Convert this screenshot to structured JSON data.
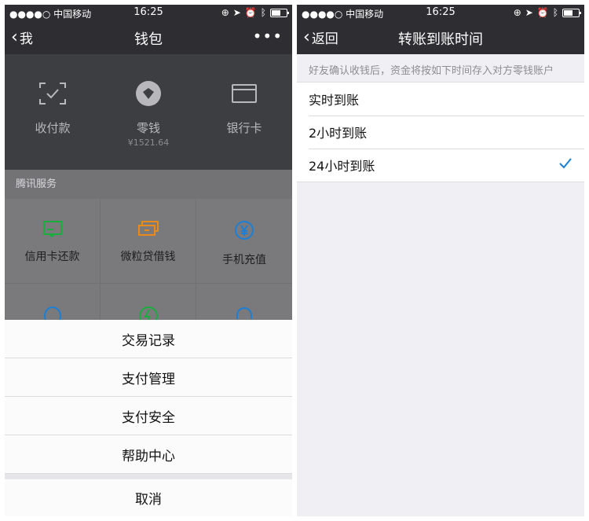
{
  "left": {
    "status": {
      "carrier": "●●●●○ 中国移动",
      "time": "16:25"
    },
    "nav": {
      "back": "我",
      "title": "钱包",
      "more": "•••"
    },
    "wallet": [
      {
        "label": "收付款",
        "sub": "",
        "icon": "scan-pay-icon"
      },
      {
        "label": "零钱",
        "sub": "¥1521.64",
        "icon": "change-icon"
      },
      {
        "label": "银行卡",
        "sub": "",
        "icon": "bank-card-icon"
      }
    ],
    "section_label": "腾讯服务",
    "services": [
      {
        "label": "信用卡还款",
        "icon": "credit-card-icon",
        "color": "#19ad3e"
      },
      {
        "label": "微粒贷借钱",
        "icon": "loan-icon",
        "color": "#e98b1c"
      },
      {
        "label": "手机充值",
        "icon": "yuan-icon",
        "color": "#1a7fd6"
      }
    ],
    "sheet": {
      "items": [
        "交易记录",
        "支付管理",
        "支付安全",
        "帮助中心"
      ],
      "cancel": "取消"
    }
  },
  "right": {
    "status": {
      "carrier": "●●●●○ 中国移动",
      "time": "16:25"
    },
    "nav": {
      "back": "返回",
      "title": "转账到账时间"
    },
    "note": "好友确认收钱后，资金将按如下时间存入对方零钱账户",
    "options": [
      {
        "label": "实时到账",
        "selected": false
      },
      {
        "label": "2小时到账",
        "selected": false
      },
      {
        "label": "24小时到账",
        "selected": true
      }
    ],
    "check_color": "#1a7fd6"
  }
}
